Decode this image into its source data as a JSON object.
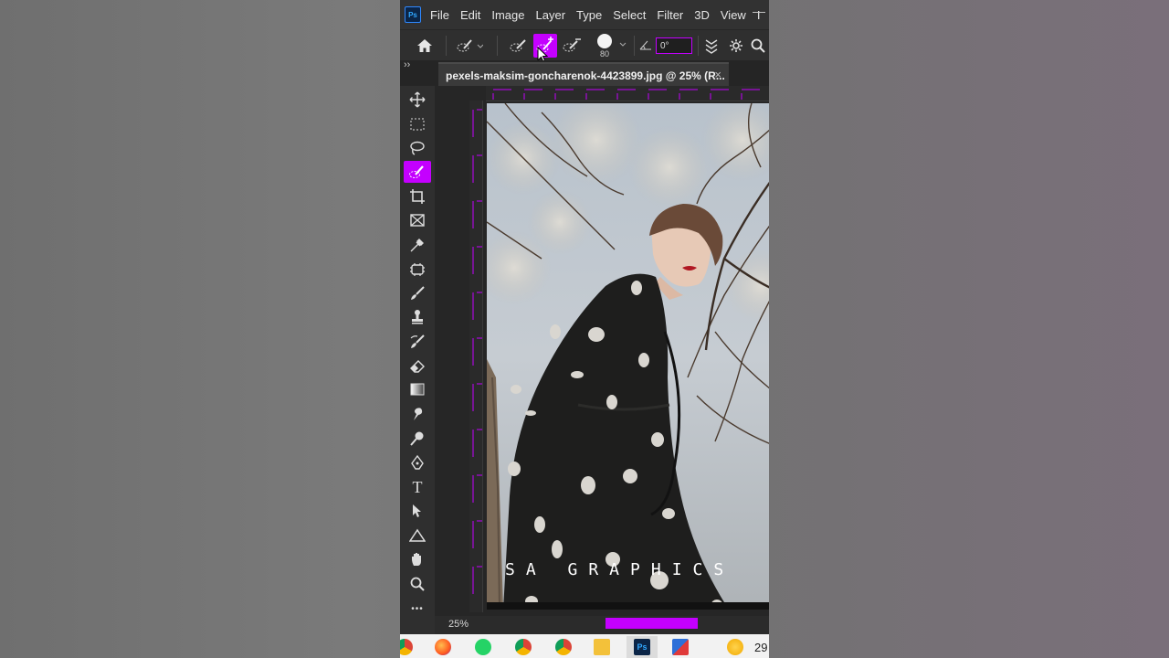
{
  "app": {
    "logo_text": "Ps"
  },
  "menu": [
    "File",
    "Edit",
    "Image",
    "Layer",
    "Type",
    "Select",
    "Filter",
    "3D",
    "View",
    "I"
  ],
  "window": {
    "minimize": "—"
  },
  "options": {
    "brush_size": "80",
    "angle": "0°"
  },
  "tab": {
    "title": "pexels-maksim-goncharenok-4423899.jpg @ 25% (R...",
    "close": "×"
  },
  "toolbar": {
    "collapse": "››",
    "tools": [
      "move-tool-icon",
      "marquee-tool-icon",
      "lasso-tool-icon",
      "quick-selection-tool-icon",
      "crop-tool-icon",
      "frame-tool-icon",
      "eyedropper-tool-icon",
      "patch-tool-icon",
      "brush-tool-icon",
      "stamp-tool-icon",
      "history-brush-icon",
      "eraser-tool-icon",
      "gradient-tool-icon",
      "smudge-tool-icon",
      "dodge-tool-icon",
      "pen-tool-icon",
      "type-tool-icon",
      "path-selection-icon",
      "shape-tool-icon",
      "hand-tool-icon",
      "zoom-tool-icon",
      "more-tools-icon"
    ],
    "active_index": 3,
    "type_glyph": "T",
    "more_glyph": "•••"
  },
  "canvas": {
    "watermark": "SA GRAPHICS"
  },
  "status": {
    "zoom": "25%"
  },
  "taskbar": {
    "time_fragment": "29"
  },
  "colors": {
    "accent": "#c400ff",
    "ui_dark": "#2b2b2b"
  }
}
